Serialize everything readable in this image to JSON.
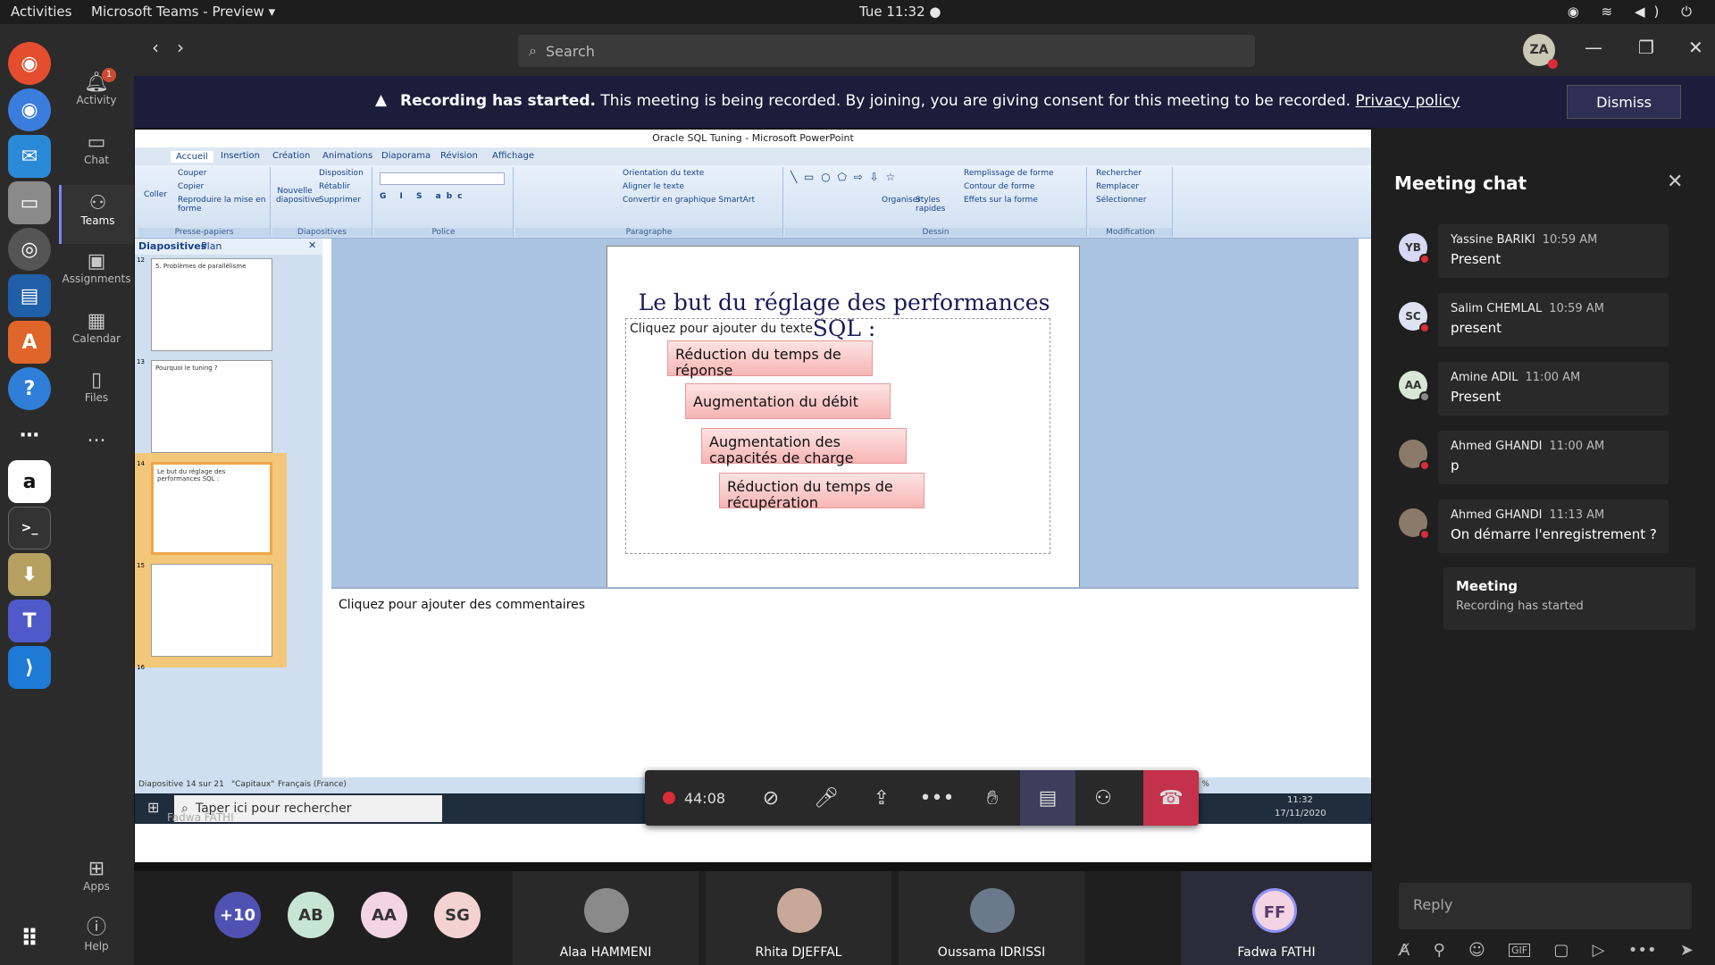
{
  "os": {
    "activities": "Activities",
    "app_name": "Microsoft Teams - Preview ▾",
    "clock": "Tue 11:32 ●"
  },
  "teams": {
    "rail": [
      {
        "label": "Activity",
        "badge": "1"
      },
      {
        "label": "Chat"
      },
      {
        "label": "Teams"
      },
      {
        "label": "Assignments"
      },
      {
        "label": "Calendar"
      },
      {
        "label": "Files"
      },
      {
        "label": "..."
      },
      {
        "label": "Apps"
      },
      {
        "label": "Help"
      }
    ],
    "search_placeholder": "Search",
    "user_initials": "ZA"
  },
  "banner": {
    "bold": "Recording has started.",
    "text": "This meeting is being recorded. By joining, you are giving consent for this meeting to be recorded.",
    "link": "Privacy policy",
    "dismiss": "Dismiss"
  },
  "powerpoint": {
    "title": "Oracle SQL Tuning - Microsoft PowerPoint",
    "tabs": [
      "Accueil",
      "Insertion",
      "Création",
      "Animations",
      "Diaporama",
      "Révision",
      "Affichage"
    ],
    "groups": {
      "clipboard": {
        "name": "Presse-papiers",
        "paste": "Coller",
        "cut": "Couper",
        "copy": "Copier",
        "format": "Reproduire la mise en forme"
      },
      "slides": {
        "name": "Diapositives",
        "new": "Nouvelle diapositive",
        "layout": "Disposition",
        "reset": "Rétablir",
        "delete": "Supprimer"
      },
      "font": {
        "name": "Police"
      },
      "paragraph": {
        "name": "Paragraphe",
        "orientation": "Orientation du texte",
        "align": "Aligner le texte",
        "smartart": "Convertir en graphique SmartArt"
      },
      "drawing": {
        "name": "Dessin",
        "arrange": "Organiser",
        "styles": "Styles rapides",
        "fill": "Remplissage de forme",
        "outline": "Contour de forme",
        "effects": "Effets sur la forme"
      },
      "editing": {
        "name": "Modification",
        "find": "Rechercher",
        "replace": "Remplacer",
        "select": "Sélectionner"
      }
    },
    "pane_tabs": {
      "slides": "Diapositives",
      "outline": "Plan"
    },
    "thumbs": [
      {
        "num": "12",
        "title": "5. Problèmes de parallélisme"
      },
      {
        "num": "13",
        "title": "Pourquoi le tuning ?"
      },
      {
        "num": "14",
        "title": "Le but du réglage des performances SQL :"
      },
      {
        "num": "15",
        "title": ""
      },
      {
        "num": "16",
        "title": ""
      }
    ],
    "slide": {
      "title": "Le but du réglage des performances SQL :",
      "placeholder": "Cliquez pour ajouter du texte",
      "steps": [
        "Réduction du temps de réponse",
        "Augmentation du débit",
        "Augmentation des capacités de charge",
        "Réduction du temps de récupération"
      ]
    },
    "notes": "Cliquez pour ajouter des commentaires",
    "status": {
      "slide": "Diapositive 14 sur 21",
      "theme": "\"Capitaux\"",
      "lang": "Français (France)",
      "zoom": "61 %"
    },
    "win": {
      "search": "Taper ici pour rechercher",
      "time": "11:32",
      "date": "17/11/2020",
      "presenter": "Fadwa FATHI"
    }
  },
  "call": {
    "timer": "44:08"
  },
  "participants": {
    "more": "+10",
    "bubbles": [
      "AB",
      "AA",
      "SG"
    ],
    "tiles": [
      "Alaa HAMMENI",
      "Rhita DJEFFAL",
      "Oussama IDRISSI",
      "Fadwa FATHI"
    ],
    "self_initials": "FF"
  },
  "chat": {
    "title": "Meeting chat",
    "messages": [
      {
        "initials": "YB",
        "name": "Yassine BARIKI",
        "time": "10:59 AM",
        "text": "Present"
      },
      {
        "initials": "SC",
        "name": "Salim CHEMLAL",
        "time": "10:59 AM",
        "text": "present"
      },
      {
        "initials": "AA",
        "name": "Amine ADIL",
        "time": "11:00 AM",
        "text": "Present"
      },
      {
        "initials": "",
        "name": "Ahmed GHANDI",
        "time": "11:00 AM",
        "text": "p"
      },
      {
        "initials": "",
        "name": "Ahmed GHANDI",
        "time": "11:13 AM",
        "text": "On démarre l'enregistrement ?"
      }
    ],
    "meeting_card": {
      "title": "Meeting",
      "subtitle": "Recording has started"
    },
    "reply_placeholder": "Reply"
  }
}
